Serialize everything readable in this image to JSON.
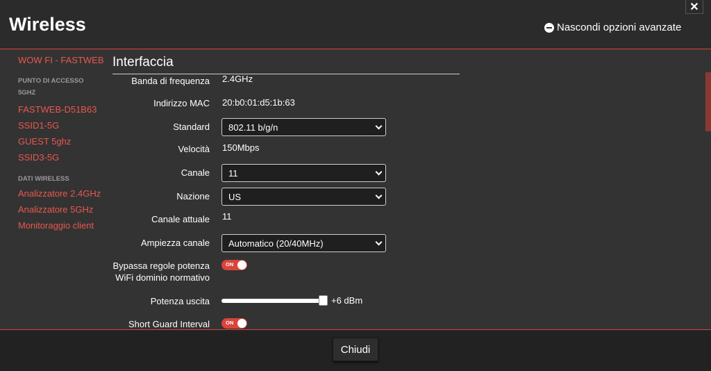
{
  "header": {
    "title": "Wireless",
    "advanced_toggle_label": "Nascondi opzioni avanzate",
    "close_symbol": "✕"
  },
  "sidebar": {
    "top_link": "WOW FI - FASTWEB",
    "ap_caption_line1": "PUNTO DI ACCESSO",
    "ap_caption_line2": "5GHZ",
    "ap_links": [
      "FASTWEB-D51B63",
      "SSID1-5G",
      "GUEST 5ghz",
      "SSID3-5G"
    ],
    "data_caption": "DATI WIRELESS",
    "data_links": [
      "Analizzatore 2.4GHz",
      "Analizzatore 5GHz",
      "Monitoraggio client"
    ]
  },
  "interface": {
    "section_title": "Interfaccia",
    "band_label": "Banda di frequenza",
    "band_value": "2.4GHz",
    "mac_label": "Indirizzo MAC",
    "mac_value": "20:b0:01:d5:1b:63",
    "standard_label": "Standard",
    "standard_value": "802.11 b/g/n",
    "speed_label": "Velocità",
    "speed_value": "150Mbps",
    "channel_label": "Canale",
    "channel_value": "11",
    "country_label": "Nazione",
    "country_value": "US",
    "current_channel_label": "Canale attuale",
    "current_channel_value": "11",
    "bandwidth_label": "Ampiezza canale",
    "bandwidth_value": "Automatico (20/40MHz)",
    "bypass_label_line1": "Bypassa regole potenza",
    "bypass_label_line2": "WiFi dominio normativo",
    "bypass_state": "ON",
    "power_label": "Potenza uscita",
    "power_value": "+6 dBm",
    "power_level_fraction": 1.0,
    "sgi_label": "Short Guard Interval",
    "sgi_state": "ON"
  },
  "footer": {
    "close_button_label": "Chiudi"
  },
  "colors": {
    "accent": "#d9443c",
    "link": "#e8584e",
    "background": "#333333"
  }
}
